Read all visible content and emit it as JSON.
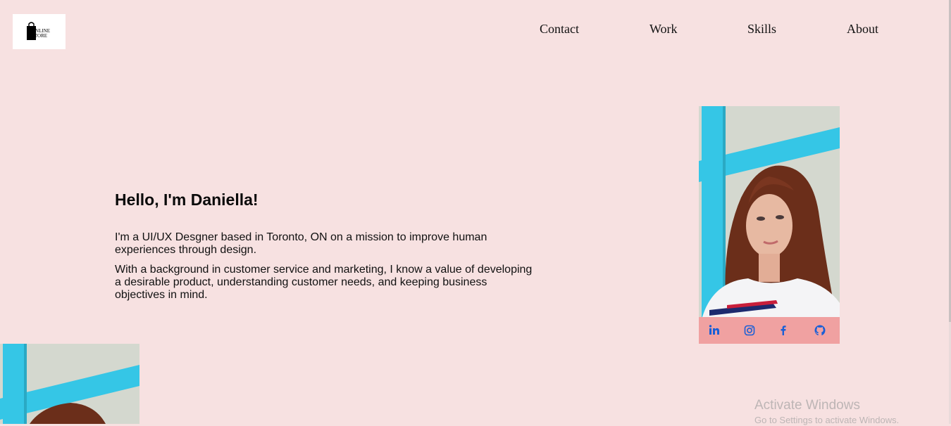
{
  "logo": {
    "line1": "Online",
    "line2": "Store",
    "icon": "shopping-bag-icon"
  },
  "nav": {
    "items": [
      {
        "label": "Contact"
      },
      {
        "label": "Work"
      },
      {
        "label": "Skills"
      },
      {
        "label": "About"
      }
    ]
  },
  "hero": {
    "title": "Hello, I'm Daniella!",
    "paragraph1": "I'm a UI/UX Desgner based in Toronto, ON on a mission to improve human experiences through design.",
    "paragraph2": "With a background in customer service and marketing, I know a value of developing a desirable product, understanding customer needs, and keeping business objectives in mind."
  },
  "social": {
    "icons": [
      "linkedin-icon",
      "instagram-icon",
      "facebook-icon",
      "github-icon"
    ],
    "icon_color": "#1a5fd6",
    "bar_color": "#f0a1a1"
  },
  "colors": {
    "background": "#f7e1e1",
    "photo_frame": "#35c6e6"
  },
  "watermark": {
    "title": "Activate Windows",
    "subtitle": "Go to Settings to activate Windows."
  }
}
